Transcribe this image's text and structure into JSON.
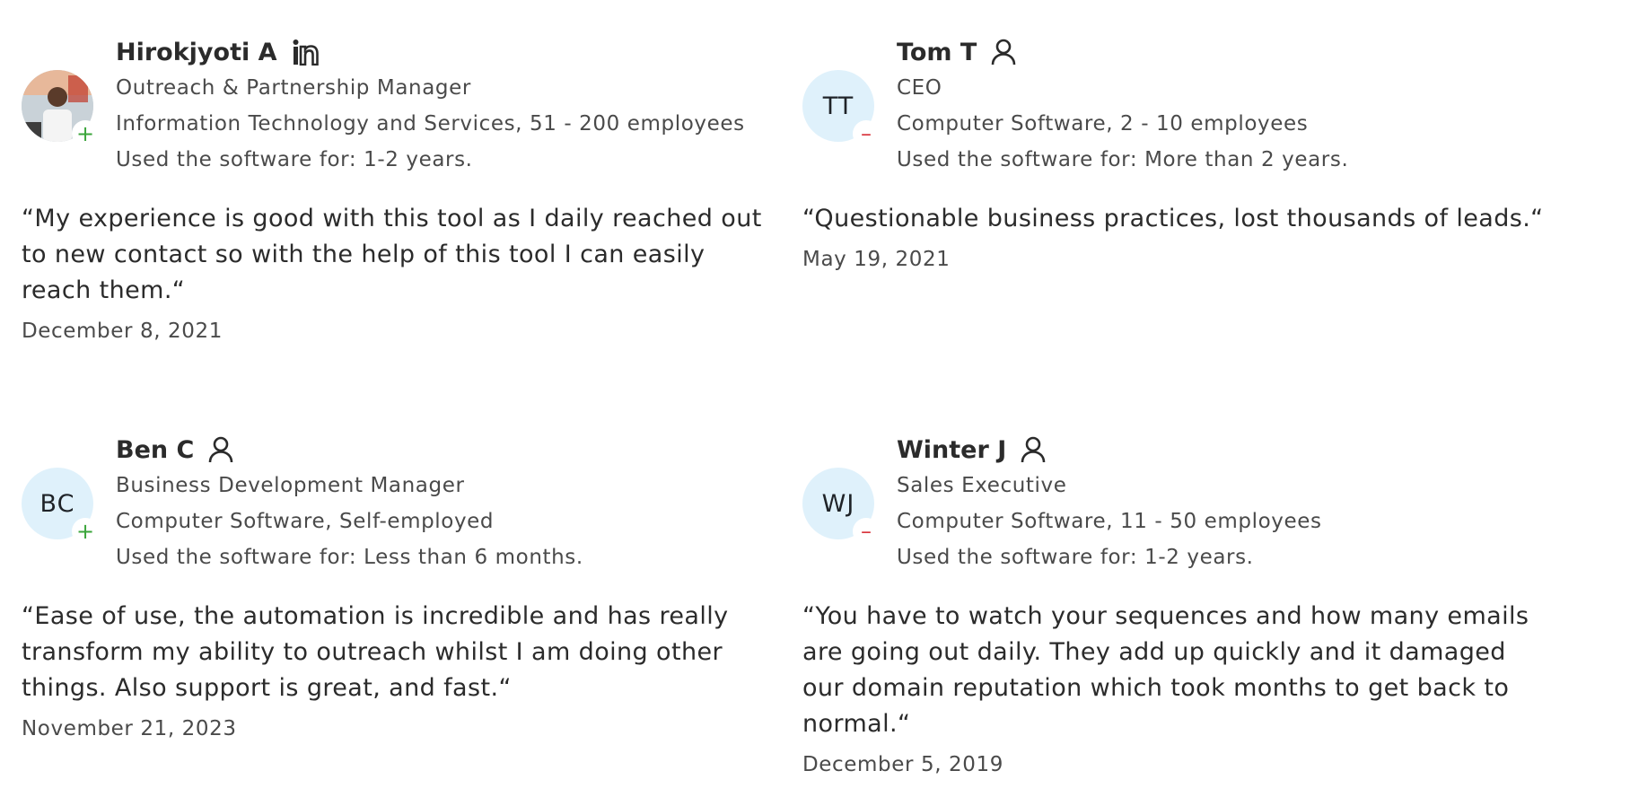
{
  "reviews": [
    {
      "name": "Hirokjyoti A",
      "name_icon": "linkedin-icon",
      "avatar_type": "photo",
      "avatar_initials": "",
      "sentiment": "positive",
      "sentiment_symbol": "+",
      "role": "Outreach & Partnership Manager",
      "company": "Information Technology and Services, 51 - 200 employees",
      "usage": "Used the software for: 1-2 years.",
      "quote": "“My experience is good with this tool as I daily reached out to new contact so with the help of this tool I can easily reach them.“",
      "date": "December 8, 2021"
    },
    {
      "name": "Tom T",
      "name_icon": "user-icon",
      "avatar_type": "initials",
      "avatar_initials": "TT",
      "sentiment": "negative",
      "sentiment_symbol": "–",
      "role": "CEO",
      "company": "Computer Software, 2 - 10 employees",
      "usage": "Used the software for: More than 2 years.",
      "quote": "“Questionable business practices, lost thousands of leads.“",
      "date": "May 19, 2021"
    },
    {
      "name": "Ben C",
      "name_icon": "user-icon",
      "avatar_type": "initials",
      "avatar_initials": "BC",
      "sentiment": "positive",
      "sentiment_symbol": "+",
      "role": "Business Development Manager",
      "company": "Computer Software, Self-employed",
      "usage": "Used the software for: Less than 6 months.",
      "quote": "“Ease of use, the automation is incredible and has really transform my ability to outreach whilst I am doing other things. Also support is great, and fast.“",
      "date": "November 21, 2023"
    },
    {
      "name": "Winter J",
      "name_icon": "user-icon",
      "avatar_type": "initials",
      "avatar_initials": "WJ",
      "sentiment": "negative",
      "sentiment_symbol": "–",
      "role": "Sales Executive",
      "company": "Computer Software, 11 - 50 employees",
      "usage": "Used the software for: 1-2 years.",
      "quote": "“You have to watch your sequences and how many emails are going out daily. They add up quickly and it damaged our domain reputation which took months to get back to normal.“",
      "date": "December 5, 2019"
    }
  ],
  "colors": {
    "positive": "#3aa53a",
    "negative": "#d9363e",
    "avatar_bg": "#dff1fb"
  }
}
